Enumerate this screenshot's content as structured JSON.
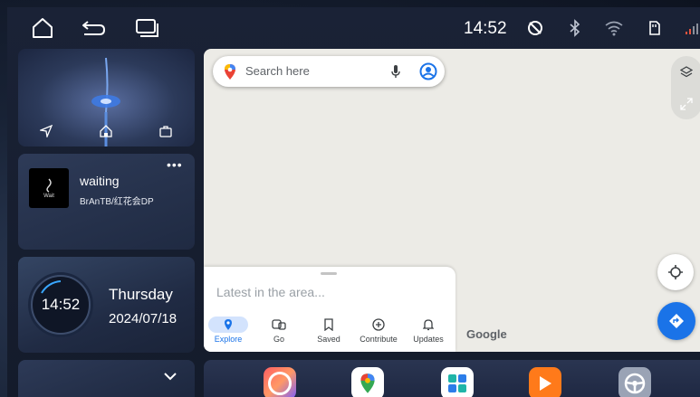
{
  "status": {
    "time": "14:52"
  },
  "music": {
    "title": "waiting",
    "artist": "BrAnTB/红花会DP",
    "album_art_text": "Wait"
  },
  "clock": {
    "time": "14:52",
    "day": "Thursday",
    "date": "2024/07/18"
  },
  "map": {
    "search_placeholder": "Search here",
    "sheet_title": "Latest in the area...",
    "watermark": "Google",
    "tabs": [
      {
        "label": "Explore",
        "icon": "pin-icon",
        "active": true
      },
      {
        "label": "Go",
        "icon": "commute-icon"
      },
      {
        "label": "Saved",
        "icon": "bookmark-icon"
      },
      {
        "label": "Contribute",
        "icon": "add-circle-icon"
      },
      {
        "label": "Updates",
        "icon": "bell-icon"
      }
    ]
  },
  "dock": {
    "apps": [
      "color-ring-app-icon",
      "maps-app-icon",
      "apps-grid-icon",
      "video-player-app-icon",
      "steering-wheel-app-icon"
    ]
  },
  "colors": {
    "accent": "#1a73e8",
    "map_bg": "#ecebe6",
    "active_tab_bg": "#d3e3fd"
  }
}
